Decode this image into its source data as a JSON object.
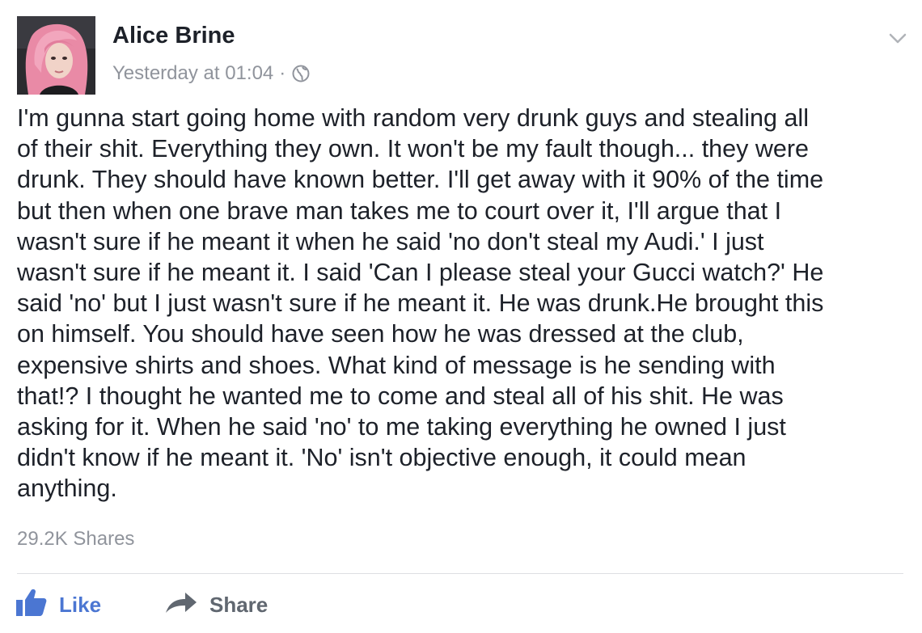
{
  "post": {
    "author_name": "Alice Brine",
    "timestamp": "Yesterday at 01:04",
    "separator": "·",
    "privacy_icon": "globe-icon",
    "menu_icon": "chevron-down-icon",
    "body_lines": [
      "I'm gunna start going home with random very drunk guys and stealing all",
      "of their shit. Everything they own. It won't be my fault though... they were",
      "drunk. They should have known better. I'll get away with it 90% of the time",
      "but then when one brave man takes me to court over it, I'll argue that I",
      "wasn't sure if he meant it when he said 'no don't steal my Audi.' I just",
      "wasn't sure if he meant it. I said 'Can I please steal your Gucci watch?' He",
      "said 'no' but I just wasn't sure if he meant it. He was drunk.He brought this",
      "on himself. You should have seen how he was dressed at the club,",
      "expensive shirts and shoes. What kind of message is he sending with",
      "that!? I thought he wanted me to come and steal all of his shit. He was",
      "asking for it. When he said 'no' to me taking everything he owned I just",
      "didn't know if he meant it. 'No' isn't objective enough, it could mean",
      "anything."
    ],
    "shares_count": "29.2K Shares"
  },
  "actions": {
    "like_label": "Like",
    "like_icon": "thumbs-up-icon",
    "share_label": "Share",
    "share_icon": "share-arrow-icon"
  },
  "colors": {
    "text": "#1d2129",
    "meta": "#90949c",
    "like_blue": "#4b76d2",
    "share_gray": "#606770",
    "divider": "#dddfe2"
  }
}
